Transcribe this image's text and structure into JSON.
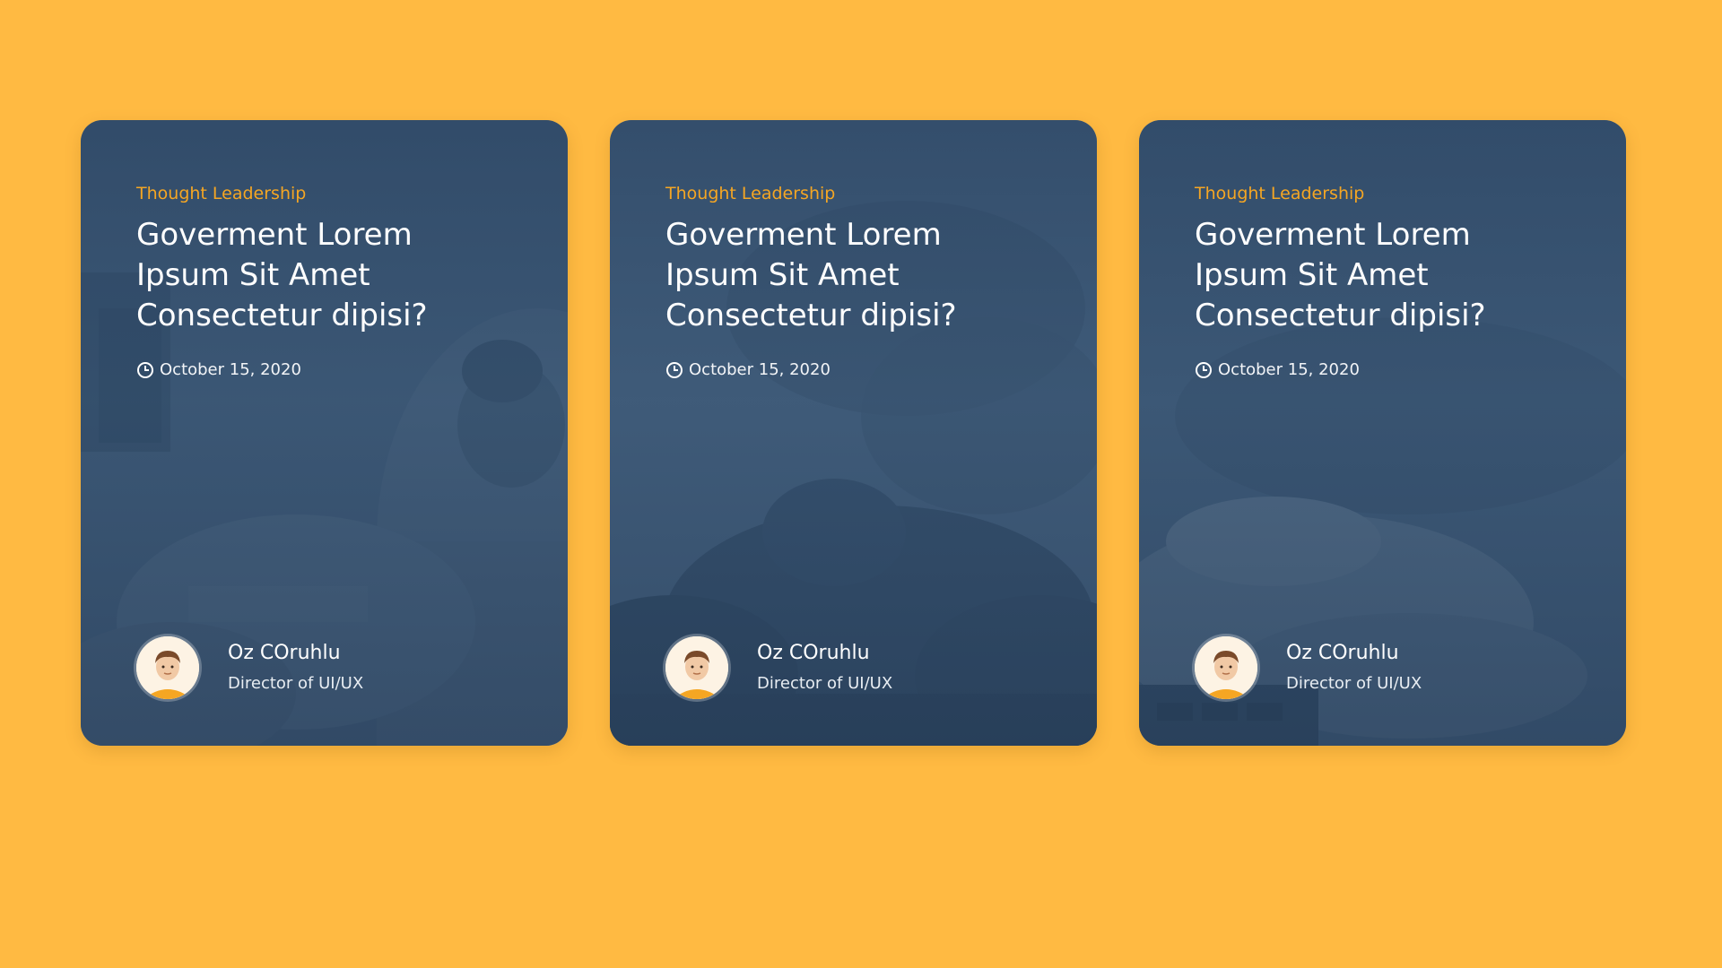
{
  "colors": {
    "background": "#FFBA42",
    "category": "#F5A623",
    "card_overlay": "#2C4664"
  },
  "cards": [
    {
      "category": "Thought Leadership",
      "title": "Goverment Lorem Ipsum Sit Amet Consectetur dipisi?",
      "date": "October 15, 2020",
      "author_name": "Oz COruhlu",
      "author_role": "Director of UI/UX",
      "image": "workers-photo"
    },
    {
      "category": "Thought Leadership",
      "title": "Goverment Lorem Ipsum Sit Amet Consectetur dipisi?",
      "date": "October 15, 2020",
      "author_name": "Oz COruhlu",
      "author_role": "Director of UI/UX",
      "image": "trees-photo"
    },
    {
      "category": "Thought Leadership",
      "title": "Goverment Lorem Ipsum Sit Amet Consectetur dipisi?",
      "date": "October 15, 2020",
      "author_name": "Oz COruhlu",
      "author_role": "Director of UI/UX",
      "image": "typing-hands-photo"
    }
  ]
}
